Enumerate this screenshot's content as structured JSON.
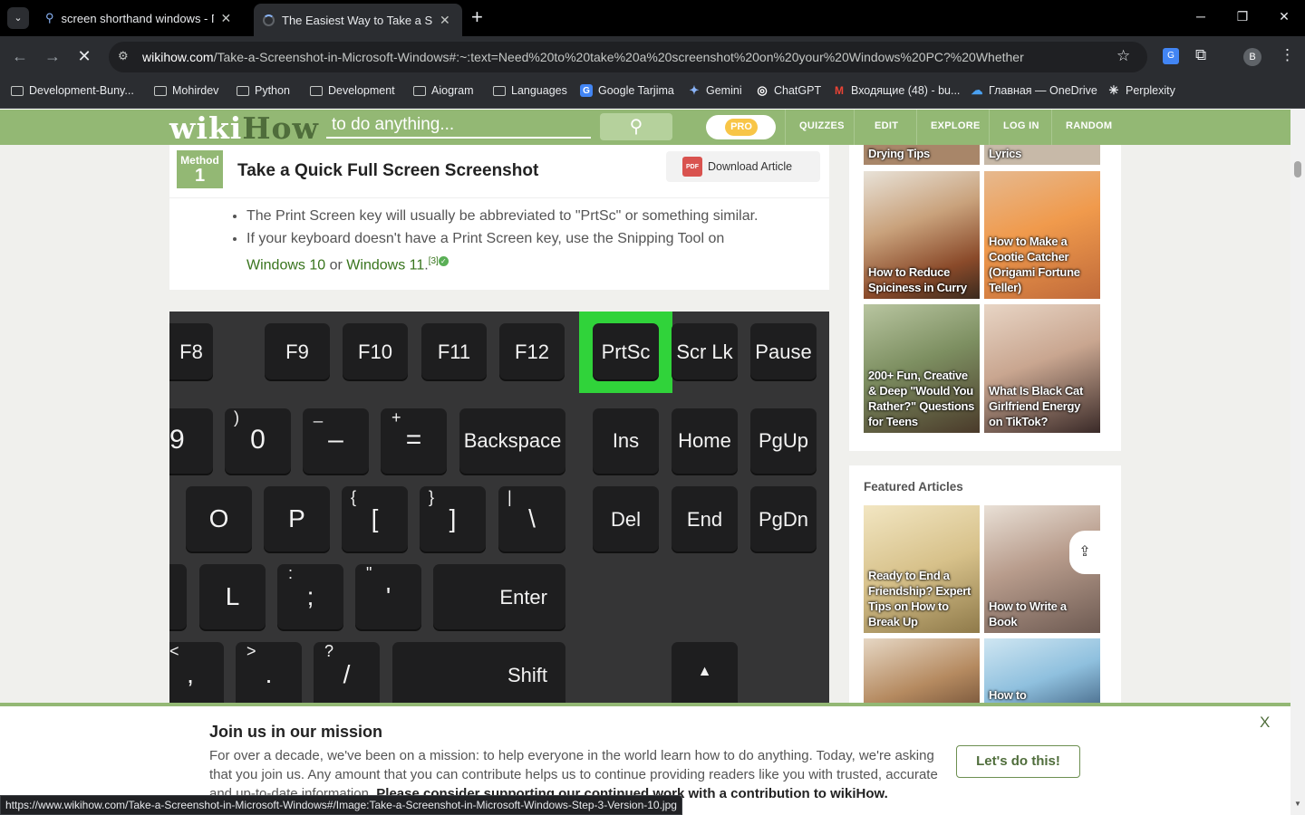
{
  "browser": {
    "tabs": [
      {
        "title": "screen shorthand windows - По",
        "icon": "search-icon"
      },
      {
        "title": "The Easiest Way to Take a Scree",
        "icon": "spinner-icon"
      }
    ],
    "new_tab": "+",
    "url_domain": "wikihow.com",
    "url_path": "/Take-a-Screenshot-in-Microsoft-Windows#:~:text=Need%20to%20take%20a%20screenshot%20on%20your%20Windows%20PC?%20Whether",
    "profile": "B",
    "bookmarks": [
      {
        "label": "Development-Buny...",
        "type": "folder"
      },
      {
        "label": "Mohirdev",
        "type": "folder"
      },
      {
        "label": "Python",
        "type": "folder"
      },
      {
        "label": "Development",
        "type": "folder"
      },
      {
        "label": "Aiogram",
        "type": "folder"
      },
      {
        "label": "Languages",
        "type": "folder"
      },
      {
        "label": "Google Tarjima",
        "type": "site",
        "color": "#4285f4",
        "glyph": "G"
      },
      {
        "label": "Gemini",
        "type": "site",
        "color": "#8ab4f8",
        "glyph": "✦"
      },
      {
        "label": "ChatGPT",
        "type": "site",
        "color": "#ffffff",
        "glyph": "◎"
      },
      {
        "label": "Входящие (48) - bu...",
        "type": "site",
        "color": "#ea4335",
        "glyph": "M"
      },
      {
        "label": "Главная — OneDrive",
        "type": "site",
        "color": "#0f6cbd",
        "glyph": "☁"
      },
      {
        "label": "Perplexity",
        "type": "site",
        "color": "#20808d",
        "glyph": "✳"
      }
    ],
    "status_url": "https://www.wikihow.com/Take-a-Screenshot-in-Microsoft-Windows#/Image:Take-a-Screenshot-in-Microsoft-Windows-Step-3-Version-10.jpg"
  },
  "wikihow": {
    "logo_wiki": "wiki",
    "logo_how": "How",
    "search_placeholder": "to do anything...",
    "pro": "PRO",
    "nav": [
      "QUIZZES",
      "EDIT",
      "EXPLORE",
      "LOG IN",
      "RANDOM"
    ],
    "method_label": "Method",
    "method_number": "1",
    "method_title": "Take a Quick Full Screen Screenshot",
    "download": "Download Article",
    "pdf": "PDF",
    "bullet1": "The Print Screen key will usually be abbreviated to \"PrtSc\" or something similar.",
    "bullet2_pre": "If your keyboard doesn't have a Print Screen key, use the Snipping Tool on",
    "bullet2_link1": "Windows 10",
    "bullet2_or": " or ",
    "bullet2_link2": "Windows 11",
    "bullet2_ref": "[3]"
  },
  "keyboard": {
    "row1": [
      "F8",
      "F9",
      "F10",
      "F11",
      "F12",
      "PrtSc",
      "Scr Lk",
      "Pause"
    ],
    "row2": [
      {
        "main": "9",
        "top": ""
      },
      {
        "main": "0",
        "top": ")"
      },
      {
        "main": "–",
        "top": "_"
      },
      {
        "main": "=",
        "top": "+"
      },
      {
        "main": "Backspace",
        "top": ""
      },
      {
        "main": "Ins",
        "top": ""
      },
      {
        "main": "Home",
        "top": ""
      },
      {
        "main": "PgUp",
        "top": ""
      }
    ],
    "row3": [
      {
        "main": "O",
        "top": ""
      },
      {
        "main": "P",
        "top": ""
      },
      {
        "main": "[",
        "top": "{"
      },
      {
        "main": "]",
        "top": "}"
      },
      {
        "main": "\\",
        "top": "|"
      },
      {
        "main": "Del",
        "top": ""
      },
      {
        "main": "End",
        "top": ""
      },
      {
        "main": "PgDn",
        "top": ""
      }
    ],
    "row4": [
      {
        "main": "L",
        "top": ""
      },
      {
        "main": ";",
        "top": ":"
      },
      {
        "main": "'",
        "top": "\""
      },
      {
        "main": "Enter",
        "top": ""
      }
    ],
    "row5": [
      {
        "main": ",",
        "top": "<"
      },
      {
        "main": ".",
        "top": ">"
      },
      {
        "main": "/",
        "top": "?"
      },
      {
        "main": "Shift",
        "top": ""
      },
      {
        "main": "▲",
        "top": ""
      }
    ]
  },
  "sidebar": {
    "top_caps": [
      "Drying Tips",
      "Lyrics"
    ],
    "related": [
      {
        "cap": "How to Reduce Spiciness in Curry",
        "bg": "#8a5a3a"
      },
      {
        "cap": "How to Make a Cootie Catcher (Origami Fortune Teller)",
        "bg": "#d98b4c"
      },
      {
        "cap": "200+ Fun, Creative & Deep \"Would You Rather?\" Questions for Teens",
        "bg": "#7a8f64"
      },
      {
        "cap": "What Is Black Cat Girlfriend Energy on TikTok?",
        "bg": "#b79a86"
      }
    ],
    "featured_title": "Featured Articles",
    "featured": [
      {
        "cap": "Ready to End a Friendship? Expert Tips on How to Break Up",
        "bg": "#d8c58f"
      },
      {
        "cap": "How to Write a Book",
        "bg": "#a98d80"
      },
      {
        "cap": "",
        "bg": "#9b7054"
      },
      {
        "cap": "How to",
        "bg": "#8fc0de"
      }
    ]
  },
  "banner": {
    "title": "Join us in our mission",
    "text": "For over a decade, we've been on a mission: to help everyone in the world learn how to do anything. Today, we're asking that you join us. Any amount that you can contribute helps us to continue providing readers like you with trusted, accurate and up-to-date information. ",
    "bold": "Please consider supporting our continued work with a contribution to wikiHow.",
    "button": "Let's do this!",
    "close": "X"
  }
}
